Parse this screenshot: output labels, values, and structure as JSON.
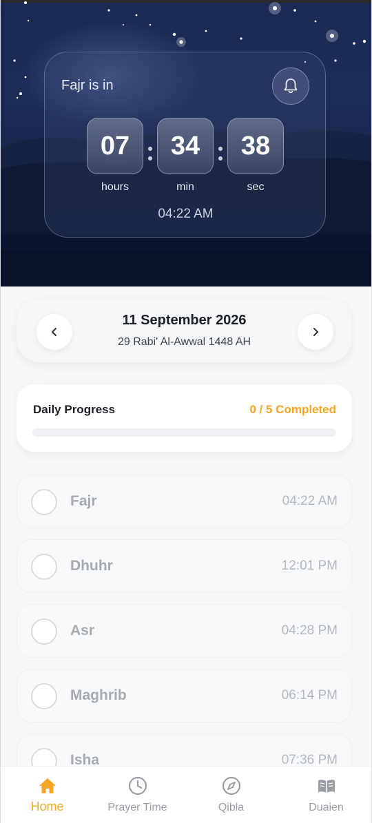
{
  "countdown": {
    "title": "Fajr is in",
    "hours": "07",
    "minutes": "34",
    "seconds": "38",
    "hours_label": "hours",
    "min_label": "min",
    "sec_label": "sec",
    "target_time": "04:22 AM"
  },
  "date": {
    "gregorian": "11 September 2026",
    "hijri": "29 Rabi' Al-Awwal 1448 AH"
  },
  "progress": {
    "title": "Daily Progress",
    "count_label": "0 / 5 Completed",
    "fraction": 0
  },
  "prayers": [
    {
      "name": "Fajr",
      "time": "04:22 AM",
      "done": false
    },
    {
      "name": "Dhuhr",
      "time": "12:01 PM",
      "done": false
    },
    {
      "name": "Asr",
      "time": "04:28 PM",
      "done": false
    },
    {
      "name": "Maghrib",
      "time": "06:14 PM",
      "done": false
    },
    {
      "name": "Isha",
      "time": "07:36 PM",
      "done": false
    }
  ],
  "nav": {
    "items": [
      {
        "label": "Home",
        "icon": "home-icon",
        "active": true
      },
      {
        "label": "Prayer Time",
        "icon": "clock-icon",
        "active": false
      },
      {
        "label": "Qibla",
        "icon": "compass-icon",
        "active": false
      },
      {
        "label": "Duaien",
        "icon": "book-icon",
        "active": false
      }
    ]
  },
  "colors": {
    "accent": "#f5a623",
    "hero": "#1b2a55"
  }
}
